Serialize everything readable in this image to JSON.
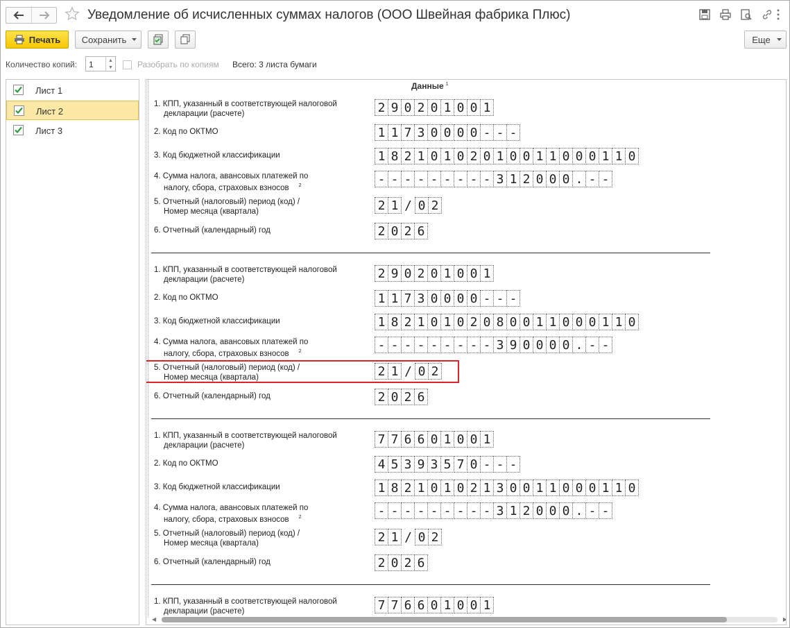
{
  "window": {
    "title": "Уведомление об исчисленных суммах налогов (ООО Швейная фабрика Плюс)"
  },
  "toolbar": {
    "print_label": "Печать",
    "save_label": "Сохранить",
    "more_label": "Еще"
  },
  "copies": {
    "label": "Количество копий:",
    "value": "1",
    "collate_label": "Разобрать по копиям",
    "total_label": "Всего: 3 листа бумаги"
  },
  "sheets": [
    {
      "label": "Лист 1",
      "checked": true,
      "selected": false
    },
    {
      "label": "Лист 2",
      "checked": true,
      "selected": true
    },
    {
      "label": "Лист 3",
      "checked": true,
      "selected": false
    }
  ],
  "document": {
    "header": "Данные",
    "header_note": "1",
    "labels": {
      "kpp_1": "1. КПП, указанный в соответствующей налоговой",
      "kpp_2": "декларации (расчете)",
      "oktmo": "2. Код по ОКТМО",
      "kbk": "3. Код бюджетной классификации",
      "sum_1": "4. Сумма налога, авансовых платежей по",
      "sum_2": "налогу, сбора, страховых взносов",
      "sum_note": "2",
      "period_1": "5. Отчетный (налоговый) период (код) /",
      "period_2": "Номер месяца (квартала)",
      "year": "6. Отчетный (календарный) год"
    },
    "blocks": [
      {
        "kpp": "290201001",
        "oktmo": "11730000---",
        "kbk": "18210102010011000110",
        "sum": "---------312000.--",
        "period": "21/02",
        "year": "2026"
      },
      {
        "kpp": "290201001",
        "oktmo": "11730000---",
        "kbk": "18210102080011000110",
        "sum": "---------390000.--",
        "period": "21/02",
        "year": "2026"
      },
      {
        "kpp": "776601001",
        "oktmo": "45393570---",
        "kbk": "18210102130011000110",
        "sum": "---------312000.--",
        "period": "21/02",
        "year": "2026"
      },
      {
        "kpp": "776601001"
      }
    ]
  },
  "colors": {
    "print_button": "#f5c800",
    "selected_row": "#fce9a6",
    "highlight_frame": "#d9252b",
    "checkmark": "#2e9a3e"
  }
}
